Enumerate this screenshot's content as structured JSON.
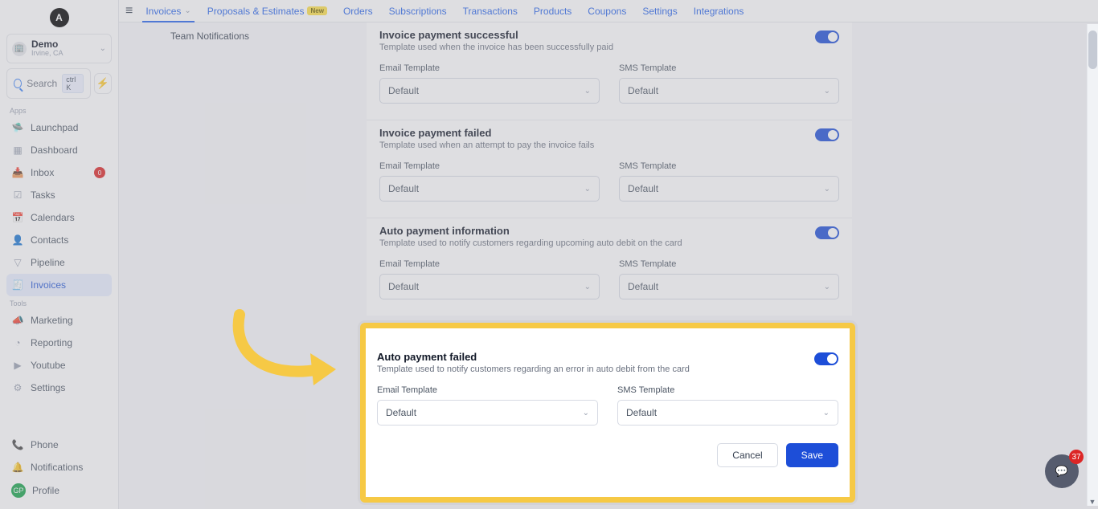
{
  "logo_letter": "A",
  "account": {
    "name": "Demo",
    "location": "Irvine, CA"
  },
  "search": {
    "label": "Search",
    "kbd": "ctrl K"
  },
  "section_apps": "Apps",
  "section_tools": "Tools",
  "nav_apps": [
    {
      "label": "Launchpad"
    },
    {
      "label": "Dashboard"
    },
    {
      "label": "Inbox",
      "badge": "0"
    },
    {
      "label": "Tasks"
    },
    {
      "label": "Calendars"
    },
    {
      "label": "Contacts"
    },
    {
      "label": "Pipeline"
    },
    {
      "label": "Invoices"
    }
  ],
  "nav_tools": [
    {
      "label": "Marketing"
    },
    {
      "label": "Reporting"
    },
    {
      "label": "Youtube"
    },
    {
      "label": "Settings"
    }
  ],
  "nav_bottom": [
    {
      "label": "Phone"
    },
    {
      "label": "Notifications"
    },
    {
      "label": "Profile",
      "initials": "GP"
    }
  ],
  "tabs": [
    {
      "label": "Invoices"
    },
    {
      "label": "Proposals & Estimates",
      "tag": "New"
    },
    {
      "label": "Orders"
    },
    {
      "label": "Subscriptions"
    },
    {
      "label": "Transactions"
    },
    {
      "label": "Products"
    },
    {
      "label": "Coupons"
    },
    {
      "label": "Settings"
    },
    {
      "label": "Integrations"
    }
  ],
  "side_sub": {
    "team_notifications": "Team Notifications"
  },
  "labels": {
    "email_template": "Email Template",
    "sms_template": "SMS Template",
    "default": "Default",
    "cancel": "Cancel",
    "save": "Save"
  },
  "sections": [
    {
      "title": "Invoice payment successful",
      "desc": "Template used when the invoice has been successfully paid"
    },
    {
      "title": "Invoice payment failed",
      "desc": "Template used when an attempt to pay the invoice fails"
    },
    {
      "title": "Auto payment information",
      "desc": "Template used to notify customers regarding upcoming auto debit on the card"
    },
    {
      "title": "Auto payment failed",
      "desc": "Template used to notify customers regarding an error in auto debit from the card"
    }
  ],
  "chat": {
    "count": "37"
  }
}
